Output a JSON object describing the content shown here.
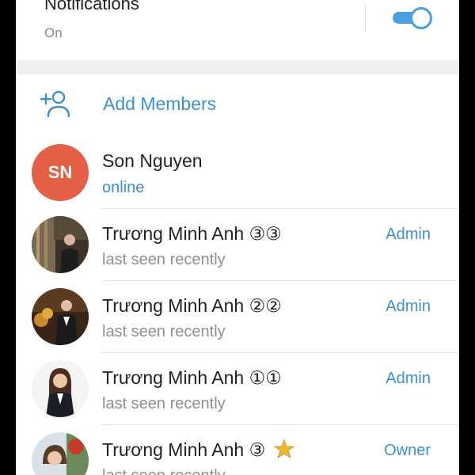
{
  "notifications": {
    "title": "Notifications",
    "status": "On",
    "enabled": true
  },
  "add_members": {
    "label": "Add Members",
    "icon": "add-person-icon"
  },
  "members": [
    {
      "initials": "SN",
      "name": "Son Nguyen",
      "status": "online",
      "role": ""
    },
    {
      "name": "Trương Minh Anh ③③",
      "status": "last seen recently",
      "role": "Admin"
    },
    {
      "name": "Trương Minh Anh ②②",
      "status": "last seen recently",
      "role": "Admin"
    },
    {
      "name": "Trương Minh Anh ①①",
      "status": "last seen recently",
      "role": "Admin"
    },
    {
      "name": "Trương Minh Anh ③",
      "status": "last seen recently",
      "role": "Owner"
    }
  ],
  "colors": {
    "accent": "#3d8fd0",
    "avatar_sn": "#e35f45"
  }
}
